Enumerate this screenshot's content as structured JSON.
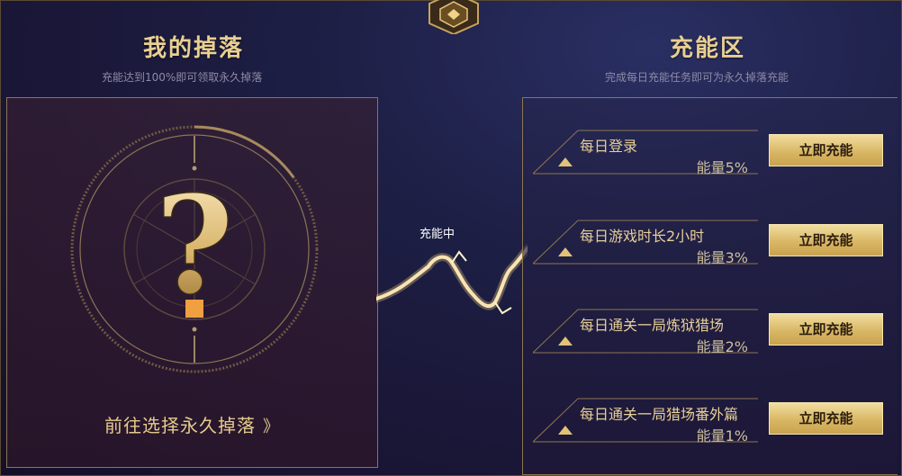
{
  "left": {
    "title": "我的掉落",
    "subtitle": "充能达到100%即可领取永久掉落",
    "mystery_symbol": "?",
    "goto_link": "前往选择永久掉落",
    "goto_arrow": "》"
  },
  "middle": {
    "status": "充能中"
  },
  "right": {
    "title": "充能区",
    "subtitle": "完成每日充能任务即可为永久掉落充能",
    "tasks": [
      {
        "name": "每日登录",
        "energy": "能量5%",
        "button": "立即充能"
      },
      {
        "name": "每日游戏时长2小时",
        "energy": "能量3%",
        "button": "立即充能"
      },
      {
        "name": "每日通关一局炼狱猎场",
        "energy": "能量2%",
        "button": "立即充能"
      },
      {
        "name": "每日通关一局猎场番外篇",
        "energy": "能量1%",
        "button": "立即充能"
      }
    ]
  },
  "colors": {
    "gold": "#e9cf92",
    "button_gold": "#d9b765",
    "mystery_orange": "#f0a040"
  }
}
